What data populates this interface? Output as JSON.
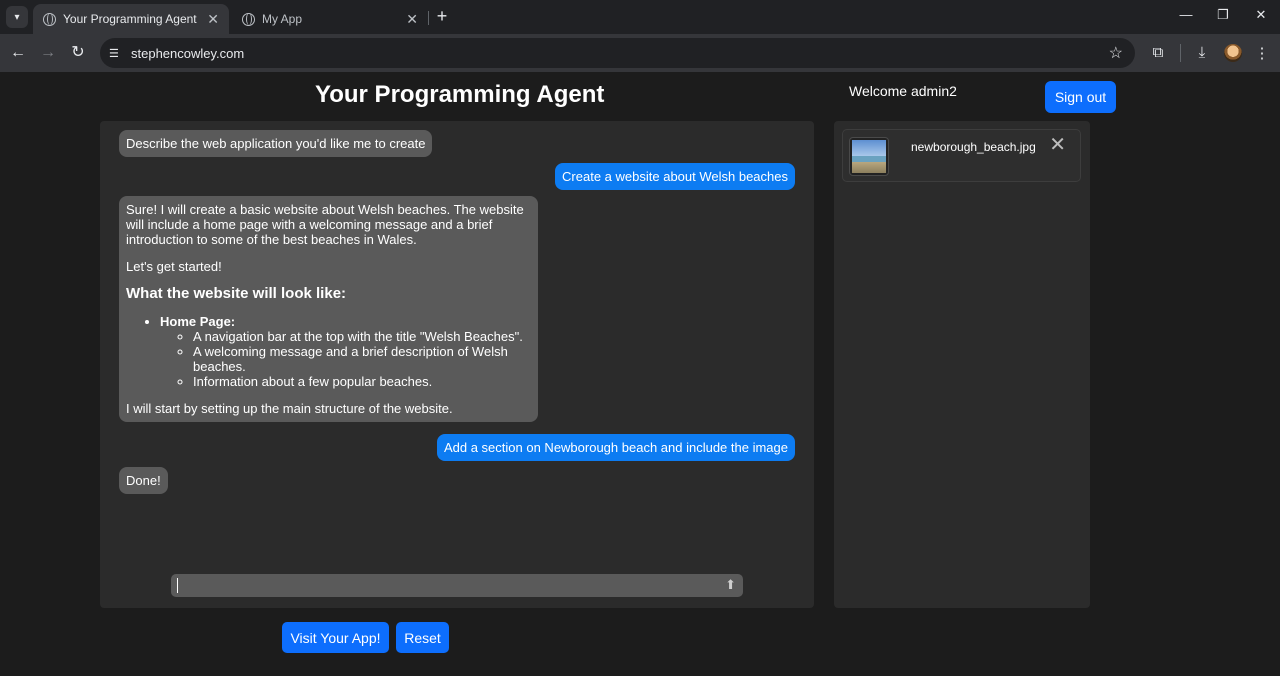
{
  "browser": {
    "tabs": [
      {
        "title": "Your Programming Agent",
        "active": true
      },
      {
        "title": "My App",
        "active": false
      }
    ],
    "url": "stephencowley.com"
  },
  "header": {
    "title": "Your Programming Agent",
    "welcome": "Welcome admin2",
    "signout_label": "Sign out"
  },
  "chat": {
    "messages": {
      "m1": "Describe the web application you'd like me to create",
      "m2": "Create a website about Welsh beaches",
      "m3": {
        "p1": "Sure! I will create a basic website about Welsh beaches. The website will include a home page with a welcoming message and a brief introduction to some of the best beaches in Wales.",
        "p2": "Let's get started!",
        "heading": "What the website will look like:",
        "item_title": "Home Page:",
        "sub1": "A navigation bar at the top with the title \"Welsh Beaches\".",
        "sub2": "A welcoming message and a brief description of Welsh beaches.",
        "sub3": "Information about a few popular beaches.",
        "p3": "I will start by setting up the main structure of the website."
      },
      "m4": "Add a section on Newborough beach and include the image",
      "m5": "Done!"
    },
    "input_value": ""
  },
  "actions": {
    "visit_label": "Visit Your App!",
    "reset_label": "Reset"
  },
  "files": [
    {
      "name": "newborough_beach.jpg"
    }
  ],
  "colors": {
    "accent": "#0d6efd",
    "user_bubble": "#0d7cf2",
    "agent_bubble": "#5a5a5a",
    "panel": "#2b2b2b",
    "background": "#1c1c1c"
  }
}
